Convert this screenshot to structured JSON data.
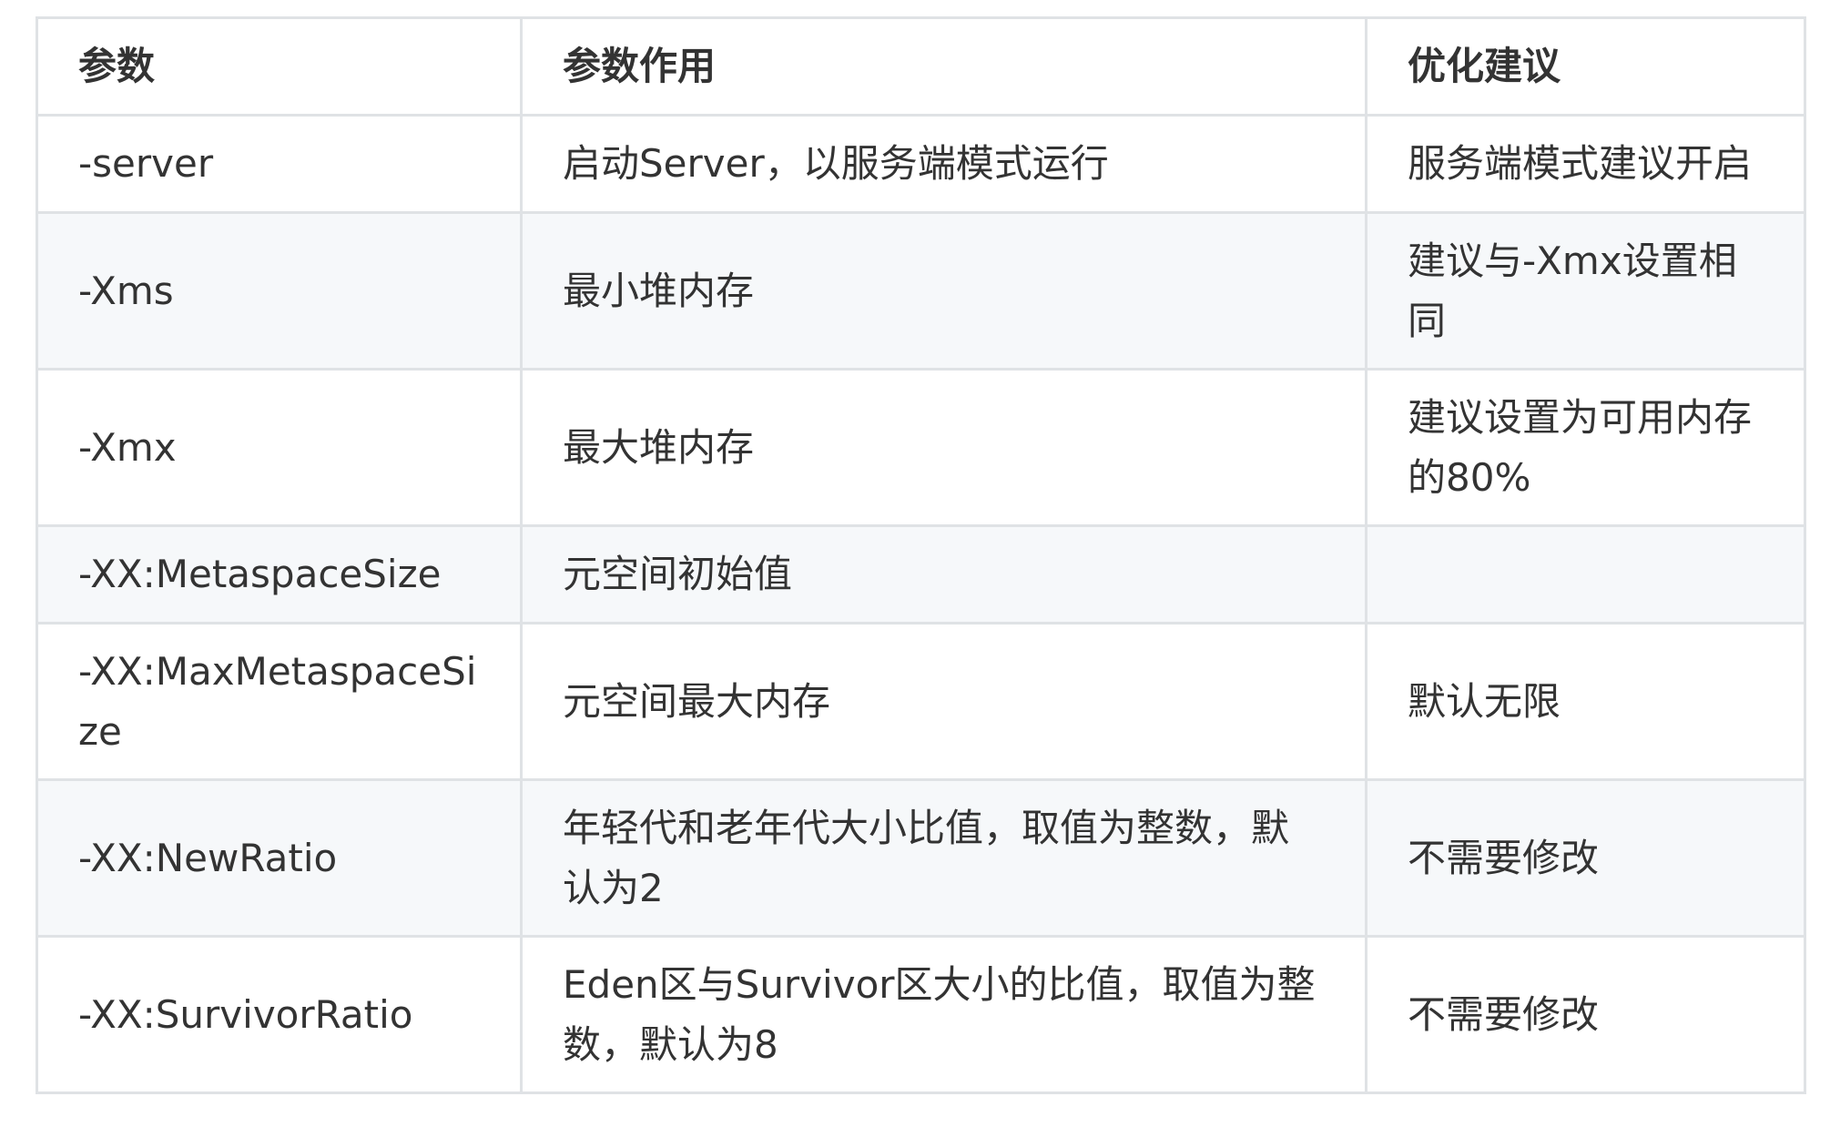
{
  "table": {
    "headers": [
      "参数",
      "参数作用",
      "优化建议"
    ],
    "rows": [
      [
        "-server",
        "启动Server，以服务端模式运行",
        "服务端模式建议开启"
      ],
      [
        "-Xms",
        "最小堆内存",
        "建议与-Xmx设置相同"
      ],
      [
        "-Xmx",
        "最大堆内存",
        "建议设置为可用内存的80%"
      ],
      [
        "-XX:MetaspaceSize",
        "元空间初始值",
        ""
      ],
      [
        "-XX:MaxMetaspaceSize",
        "元空间最大内存",
        "默认无限"
      ],
      [
        "-XX:NewRatio",
        "年轻代和老年代大小比值，取值为整数，默认为2",
        "不需要修改"
      ],
      [
        "-XX:SurvivorRatio",
        "Eden区与Survivor区大小的比值，取值为整数，默认为8",
        "不需要修改"
      ]
    ]
  }
}
